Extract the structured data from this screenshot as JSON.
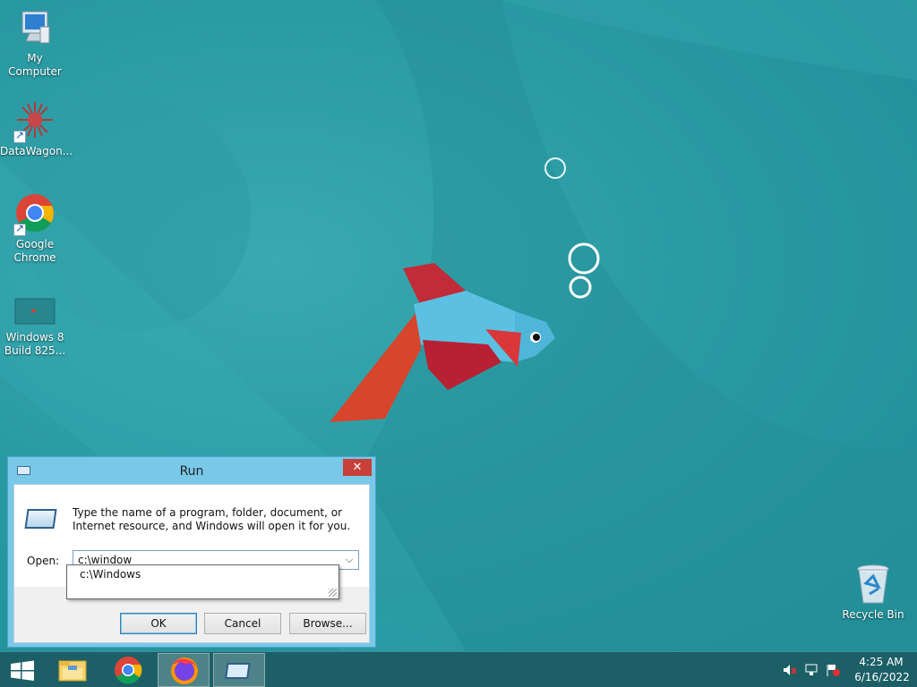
{
  "desktop": {
    "icons": [
      {
        "label": "My Computer"
      },
      {
        "label": "DataWagon..."
      },
      {
        "label": "Google Chrome"
      },
      {
        "label": "Windows 8 Build 825..."
      }
    ],
    "recycle_bin": {
      "label": "Recycle Bin"
    }
  },
  "run_dialog": {
    "title": "Run",
    "close_glyph": "✕",
    "description": "Type the name of a program, folder, document, or Internet resource, and Windows will open it for you.",
    "open_label": "Open:",
    "open_value": "c:\\window",
    "dropdown_glyph": "⌵",
    "autocomplete": [
      "c:\\Windows"
    ],
    "buttons": {
      "ok": "OK",
      "cancel": "Cancel",
      "browse": "Browse..."
    }
  },
  "taskbar": {
    "items": [
      {
        "name": "file-explorer",
        "active": false
      },
      {
        "name": "google-chrome",
        "active": false
      },
      {
        "name": "firefox",
        "active": true
      },
      {
        "name": "run",
        "active": true
      }
    ],
    "clock": {
      "time": "4:25 AM",
      "date": "6/16/2022"
    }
  },
  "colors": {
    "desktop_bg": "#2a9aa3",
    "taskbar_bg": "#1c5f67",
    "dialog_frame": "#79c8e8",
    "close_button": "#c7403a"
  }
}
